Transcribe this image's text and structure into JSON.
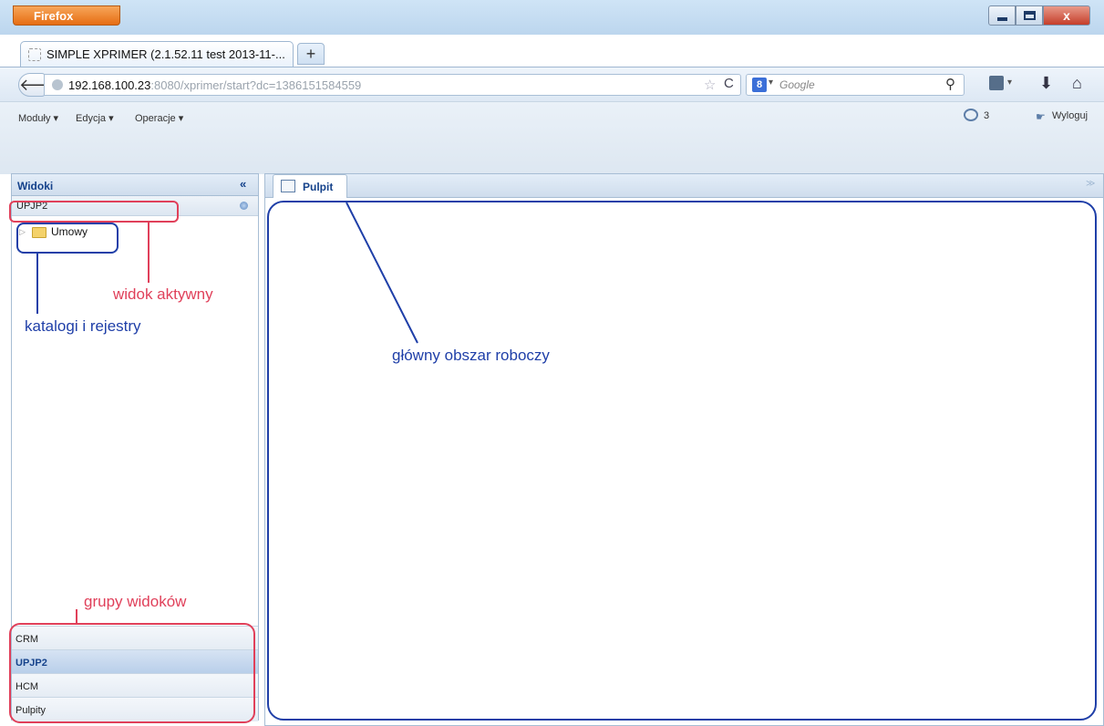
{
  "browser": {
    "app_button": "Firefox",
    "tab_title": "SIMPLE XPRIMER (2.1.52.11 test 2013-11-...",
    "new_tab": "+",
    "url_host": "192.168.100.23",
    "url_rest": ":8080/xprimer/start?dc=1386151584559",
    "search_placeholder": "Google",
    "close_glyph": "x"
  },
  "app_menu": {
    "moduly": "Moduły ▾",
    "edycja": "Edycja ▾",
    "operacje": "Operacje ▾",
    "notifications_count": "3",
    "logout": "Wyloguj"
  },
  "left_panel": {
    "title": "Widoki",
    "collapse": "«",
    "active_view": "UPJP2",
    "tree": [
      {
        "label": "Umowy"
      }
    ],
    "groups": [
      {
        "label": "CRM"
      },
      {
        "label": "UPJP2"
      },
      {
        "label": "HCM"
      },
      {
        "label": "Pulpity"
      }
    ]
  },
  "main_panel": {
    "tab": "Pulpit"
  },
  "annotations": {
    "active_view": "widok aktywny",
    "catalogs": "katalogi i rejestry",
    "view_groups": "grupy widoków",
    "work_area": "główny obszar roboczy"
  },
  "colors": {
    "annotation_red": "#e0405a",
    "annotation_blue": "#1f3fa8",
    "panel_header_text": "#15428b"
  }
}
